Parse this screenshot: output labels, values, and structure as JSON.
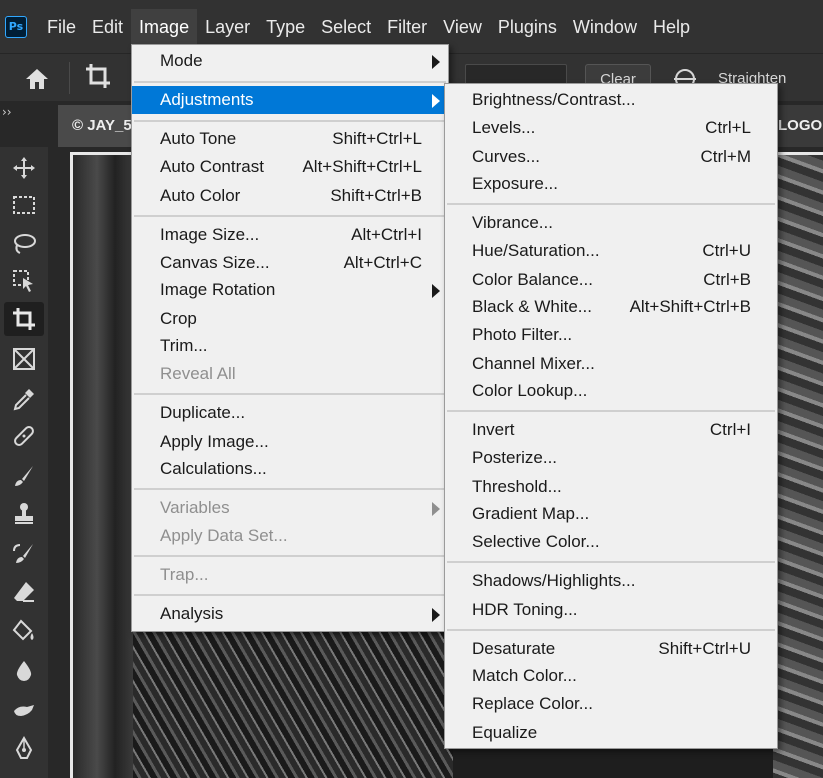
{
  "app": {
    "logo_text": "Ps"
  },
  "menubar": {
    "items": [
      "File",
      "Edit",
      "Image",
      "Layer",
      "Type",
      "Select",
      "Filter",
      "View",
      "Plugins",
      "Window",
      "Help"
    ],
    "active": "Image"
  },
  "optionsbar": {
    "clear_label": "Clear",
    "straighten_label": "Straighten"
  },
  "tabs": {
    "collapse": "››",
    "document_tab": "© JAY_5",
    "logo_tab": "LOGO"
  },
  "image_menu": {
    "mode": "Mode",
    "adjustments": "Adjustments",
    "auto_tone": "Auto Tone",
    "auto_tone_sc": "Shift+Ctrl+L",
    "auto_contrast": "Auto Contrast",
    "auto_contrast_sc": "Alt+Shift+Ctrl+L",
    "auto_color": "Auto Color",
    "auto_color_sc": "Shift+Ctrl+B",
    "image_size": "Image Size...",
    "image_size_sc": "Alt+Ctrl+I",
    "canvas_size": "Canvas Size...",
    "canvas_size_sc": "Alt+Ctrl+C",
    "image_rotation": "Image Rotation",
    "crop": "Crop",
    "trim": "Trim...",
    "reveal_all": "Reveal All",
    "duplicate": "Duplicate...",
    "apply_image": "Apply Image...",
    "calculations": "Calculations...",
    "variables": "Variables",
    "apply_data_set": "Apply Data Set...",
    "trap": "Trap...",
    "analysis": "Analysis"
  },
  "adjustments_menu": {
    "brightness_contrast": "Brightness/Contrast...",
    "levels": "Levels...",
    "levels_sc": "Ctrl+L",
    "curves": "Curves...",
    "curves_sc": "Ctrl+M",
    "exposure": "Exposure...",
    "vibrance": "Vibrance...",
    "hue_saturation": "Hue/Saturation...",
    "hue_saturation_sc": "Ctrl+U",
    "color_balance": "Color Balance...",
    "color_balance_sc": "Ctrl+B",
    "black_white": "Black & White...",
    "black_white_sc": "Alt+Shift+Ctrl+B",
    "photo_filter": "Photo Filter...",
    "channel_mixer": "Channel Mixer...",
    "color_lookup": "Color Lookup...",
    "invert": "Invert",
    "invert_sc": "Ctrl+I",
    "posterize": "Posterize...",
    "threshold": "Threshold...",
    "gradient_map": "Gradient Map...",
    "selective_color": "Selective Color...",
    "shadows_highlights": "Shadows/Highlights...",
    "hdr_toning": "HDR Toning...",
    "desaturate": "Desaturate",
    "desaturate_sc": "Shift+Ctrl+U",
    "match_color": "Match Color...",
    "replace_color": "Replace Color...",
    "equalize": "Equalize"
  },
  "colors": {
    "menu_highlight": "#0078d7",
    "ps_blue": "#31a8ff"
  },
  "tools": [
    "move-icon",
    "marquee-icon",
    "lasso-icon",
    "object-select-icon",
    "crop-icon",
    "frame-icon",
    "eyedropper-icon",
    "healing-icon",
    "brush-icon",
    "stamp-icon",
    "history-brush-icon",
    "eraser-icon",
    "paint-bucket-icon",
    "blur-icon",
    "smudge-icon",
    "pen-icon"
  ]
}
